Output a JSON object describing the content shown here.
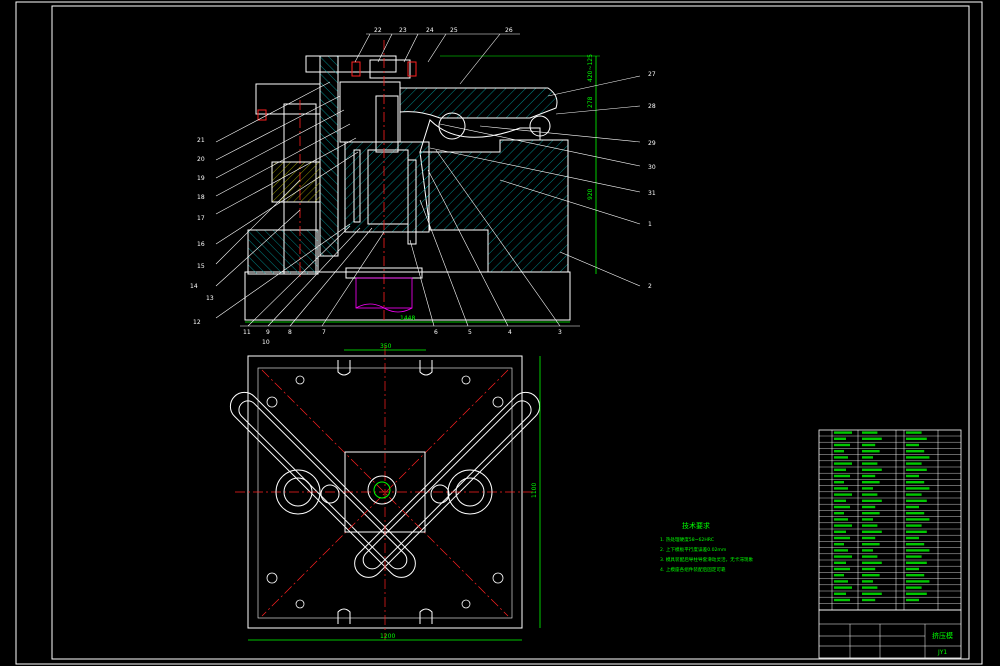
{
  "colors": {
    "background": "#000000",
    "outline": "#ffffff",
    "dimension": "#00ff00",
    "centerline": "#ff2020",
    "hatch": "#00c0c0",
    "leader": "#ffffff",
    "highlight": "#ff00ff",
    "text_green": "#00ff00"
  },
  "section_view": {
    "part_labels_top": [
      "22",
      "23",
      "24",
      "25",
      "26"
    ],
    "part_labels_right": [
      "27",
      "28",
      "29",
      "30",
      "31",
      "1",
      "2"
    ],
    "part_labels_left": [
      "21",
      "20",
      "19",
      "18",
      "17",
      "16",
      "15",
      "14",
      "13",
      "12"
    ],
    "part_labels_bottom": [
      "11",
      "9",
      "10",
      "8",
      "7",
      "6",
      "5",
      "4",
      "3"
    ],
    "dimensions": {
      "width": "1448",
      "height": "920",
      "top_right_a": "420~125",
      "top_right_b": "278"
    }
  },
  "plan_view": {
    "dimensions": {
      "top": "350",
      "bottom": "1200",
      "right": "1100"
    }
  },
  "technical_requirements": {
    "title": "技术要求",
    "items": [
      "1. 热处理硬度58~62HRC",
      "2. 上下模板平行度误差0.02mm",
      "3. 模具装配后导柱导套滑动灵活，无卡滞现象",
      "4. 上模座各组件装配后固定可靠"
    ]
  },
  "title_block": {
    "name": "挤压模",
    "code": "JY1"
  }
}
